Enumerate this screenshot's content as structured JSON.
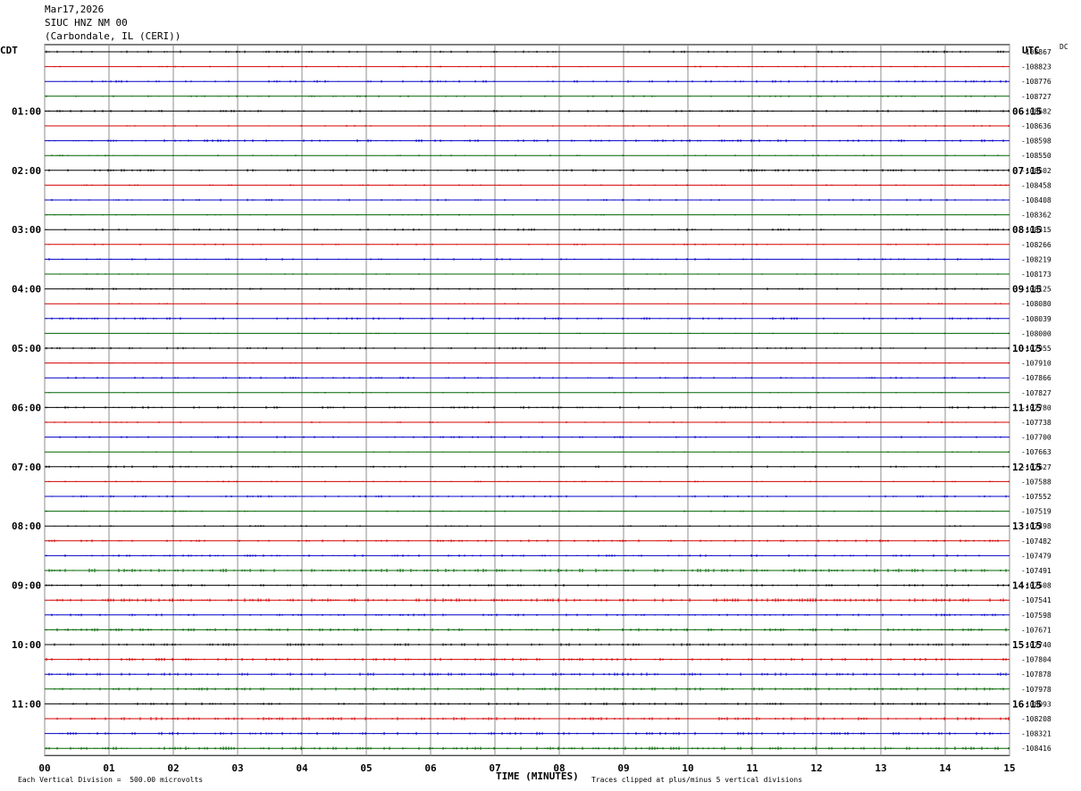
{
  "header": {
    "date": "Mar17,2026",
    "station": "SIUC HNZ NM 00",
    "location": "(Carbondale, IL (CERI))"
  },
  "labels": {
    "left_zone": "CDT",
    "right_zone": "UTC",
    "dc_label": "DC",
    "xlabel": "TIME (MINUTES)",
    "scale_note": "Each Vertical Division =  500.00 microvolts",
    "clip_note": "Traces clipped at plus/minus 5 vertical divisions"
  },
  "chart_data": {
    "type": "line",
    "title": "SIUC HNZ NM 00",
    "xlabel": "TIME (MINUTES)",
    "xlim": [
      0,
      15
    ],
    "x_ticks": [
      "00",
      "01",
      "02",
      "03",
      "04",
      "05",
      "06",
      "07",
      "08",
      "09",
      "10",
      "11",
      "12",
      "13",
      "14",
      "15"
    ],
    "trace_colors": [
      "#000000",
      "#d40000",
      "#0000c8",
      "#006400"
    ],
    "rows_per_hour": 4,
    "cdt_hour_labels": [
      "01:00",
      "02:00",
      "03:00",
      "04:00",
      "05:00",
      "06:00",
      "07:00",
      "08:00",
      "09:00",
      "10:00",
      "11:00"
    ],
    "utc_hour_labels": [
      "06:15",
      "07:15",
      "08:15",
      "09:15",
      "10:15",
      "11:15",
      "12:15",
      "13:15",
      "14:15",
      "15:15",
      "16:15"
    ],
    "dc_offsets": [
      "-108867",
      "-108823",
      "-108776",
      "-108727",
      "-108682",
      "-108636",
      "-108598",
      "-108550",
      "-108502",
      "-108458",
      "-108408",
      "-108362",
      "-108315",
      "-108266",
      "-108219",
      "-108173",
      "-108125",
      "-108080",
      "-108039",
      "-108000",
      "-107955",
      "-107910",
      "-107866",
      "-107827",
      "-107780",
      "-107738",
      "-107700",
      "-107663",
      "-107627",
      "-107588",
      "-107552",
      "-107519",
      "-107498",
      "-107482",
      "-107479",
      "-107491",
      "-107508",
      "-107541",
      "-107598",
      "-107671",
      "-107740",
      "-107804",
      "-107878",
      "-107978",
      "-108093",
      "-108208",
      "-108321",
      "-108416"
    ],
    "activity": [
      0.6,
      0.3,
      0.6,
      0.4,
      0.6,
      0.3,
      0.7,
      0.3,
      0.6,
      0.3,
      0.5,
      0.3,
      0.6,
      0.3,
      0.5,
      0.2,
      0.5,
      0.2,
      0.6,
      0.2,
      0.5,
      0.2,
      0.5,
      0.2,
      0.6,
      0.3,
      0.5,
      0.2,
      0.5,
      0.3,
      0.5,
      0.3,
      0.4,
      0.6,
      0.6,
      1.0,
      0.6,
      1.0,
      0.6,
      0.8,
      0.7,
      0.8,
      0.8,
      0.8,
      0.7,
      0.8,
      0.8,
      0.9
    ]
  }
}
